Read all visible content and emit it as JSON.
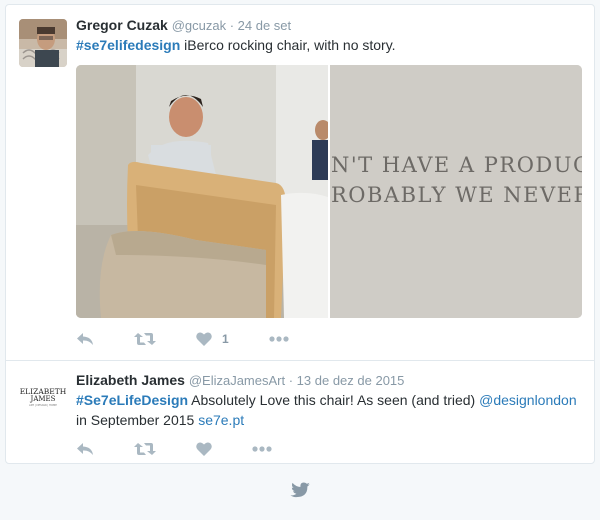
{
  "tweets": [
    {
      "fullname": "Gregor Cuzak",
      "handle": "@gcuzak",
      "separator": " · ",
      "date": "24 de set",
      "hashtag": "#se7elifedesign",
      "text": " iBerco rocking chair, with no story.",
      "media_text_line1": "N'T HAVE A PRODUCT ST",
      "media_text_line2": "ROBABLY WE NEVER",
      "like_count": "1"
    },
    {
      "fullname": "Elizabeth James",
      "handle": "@ElizaJamesArt",
      "separator": " · ",
      "date": "13 de dez de 2015",
      "hashtag": "#Se7eLifeDesign",
      "text_a": " Absolutely Love this chair! As seen (and tried) ",
      "mention": "@designlondon",
      "text_b": "in September 2015 ",
      "link": "se7e.pt",
      "logo_line1": "ELIZABETH",
      "logo_line2": "JAMES",
      "logo_tagline": "ART | DESIGN | HOME"
    }
  ],
  "colors": {
    "link": "#2b7bb9",
    "icon": "#aab8c2",
    "bird": "#8899a6"
  },
  "icons": {
    "reply": "reply-icon",
    "retweet": "retweet-icon",
    "like": "heart-icon",
    "more": "more-icon",
    "footer": "twitter-bird-icon"
  }
}
